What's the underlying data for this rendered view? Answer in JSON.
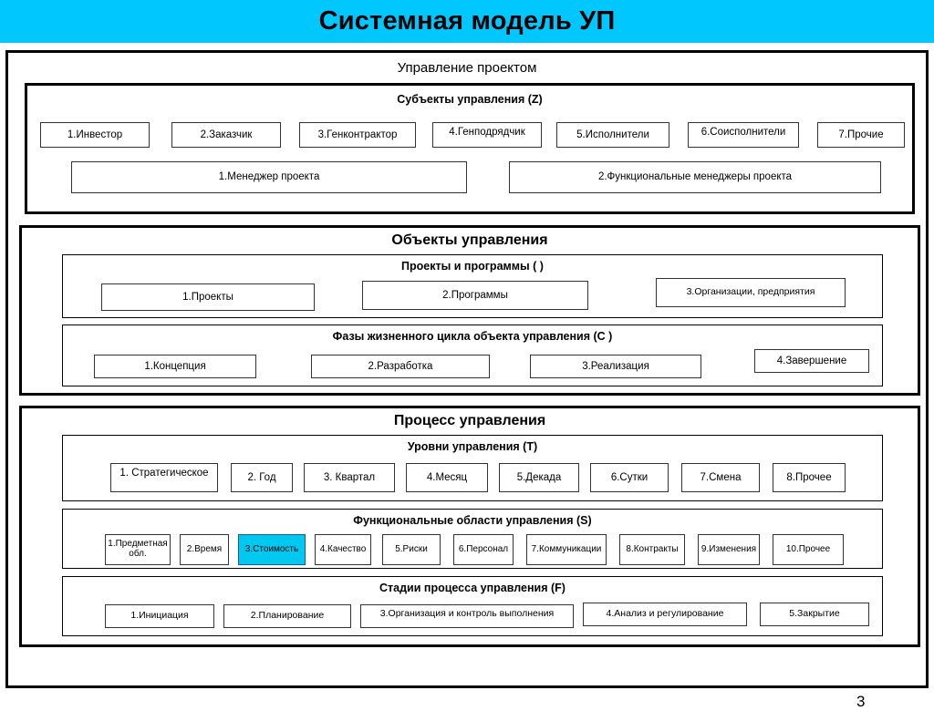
{
  "banner": {
    "title": "Системная модель УП"
  },
  "frame": {
    "title": "Управление  проектом",
    "page_number": "3"
  },
  "colors": {
    "banner_background": "#00c8ff",
    "highlight_background": "#00c8f0",
    "border": "#000000",
    "page_background": "#ffffff"
  },
  "sections": [
    {
      "id": "subjects",
      "title": "Субъекты  управления (Z)",
      "rows": [
        {
          "id": "subject-list",
          "items": [
            "1.Инвестор",
            "2.Заказчик",
            "3.Генконтрактор",
            "4.Генподрядчик",
            "5.Исполнители",
            "6.Соисполнители",
            "7.Прочие"
          ]
        },
        {
          "id": "manager-list",
          "items": [
            "1.Менеджер проекта",
            "2.Функциональные менеджеры проекта"
          ]
        }
      ]
    },
    {
      "id": "objects",
      "title": "Объекты  управления",
      "panels": [
        {
          "id": "projects-programs",
          "title": "Проекты и программы ( )",
          "items": [
            "1.Проекты",
            "2.Программы",
            "3.Организации, предприятия"
          ]
        },
        {
          "id": "lifecycle-phases",
          "title": "Фазы жизненного цикла объекта управления (С )",
          "items": [
            "1.Концепция",
            "2.Разработка",
            "3.Реализация",
            "4.Завершение"
          ]
        }
      ]
    },
    {
      "id": "process",
      "title": "Процесс управления",
      "panels": [
        {
          "id": "management-levels",
          "title": "Уровни управления (Т)",
          "items": [
            "1. Стратегическое",
            "2. Год",
            "3. Квартал",
            "4.Месяц",
            "5.Декада",
            "6.Сутки",
            "7.Смена",
            "8.Прочее"
          ]
        },
        {
          "id": "functional-areas",
          "title": "Функциональные  области  управления (S)",
          "items": [
            "1.Предметная обл.",
            "2.Время",
            "3.Стоимость",
            "4.Качество",
            "5.Риски",
            "6.Персонал",
            "7.Коммуникации",
            "8.Контракты",
            "9.Изменения",
            "10.Прочее"
          ],
          "highlighted_item": "3.Стоимость"
        },
        {
          "id": "process-stages",
          "title": "Стадии процесса управления (F)",
          "items": [
            "1.Инициация",
            "2.Планирование",
            "3.Организация и контроль выполнения",
            "4.Анализ и регулирование",
            "5.Закрытие"
          ]
        }
      ]
    }
  ]
}
